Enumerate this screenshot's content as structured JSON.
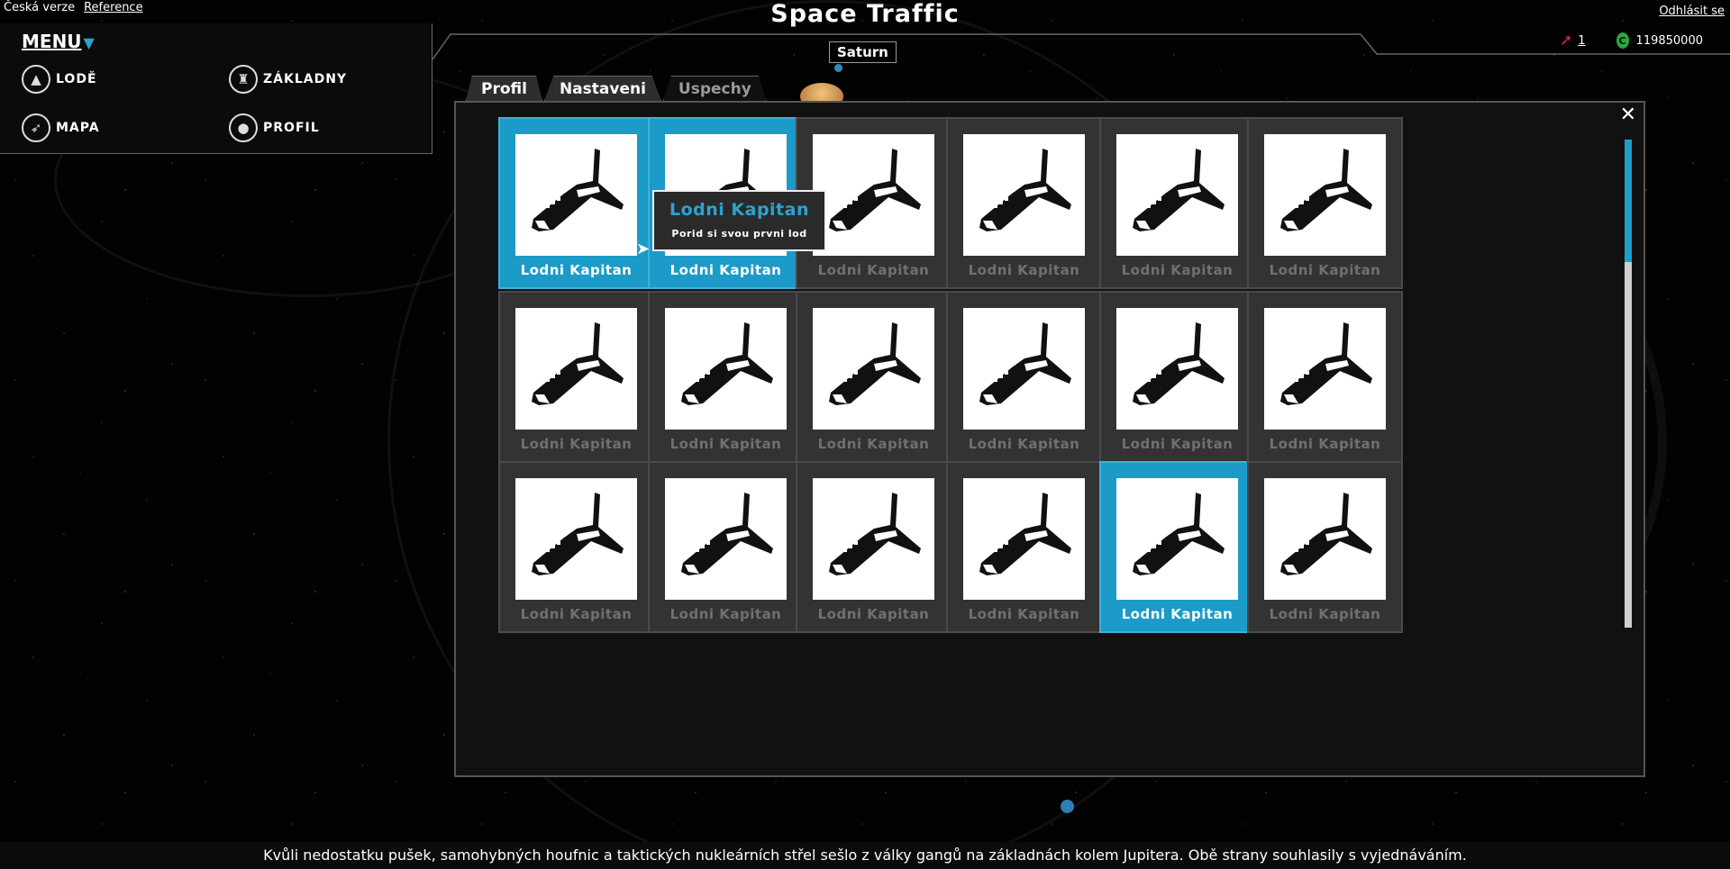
{
  "header": {
    "lang_current": "Česká verze",
    "lang_reference": "Reference",
    "title": "Space Traffic",
    "logout": "Odhlásit se"
  },
  "menu": {
    "toggle_label": "MENU",
    "items": [
      {
        "label": "LODĚ",
        "icon": "ship-icon"
      },
      {
        "label": "ZÁKLADNY",
        "icon": "base-icon"
      },
      {
        "label": "MAPA",
        "icon": "compass-icon"
      },
      {
        "label": "PROFIL",
        "icon": "user-icon"
      }
    ]
  },
  "resources": {
    "ships": "1",
    "credits": "119850000",
    "ships_icon": "rocket-icon",
    "credits_icon": "credit-coin-icon",
    "ships_color": "#e0243a",
    "credits_color": "#2aa63d"
  },
  "map": {
    "planet_label": "Saturn"
  },
  "tabs": [
    {
      "label": "Profil",
      "active": false
    },
    {
      "label": "Nastaveni",
      "active": false
    },
    {
      "label": "Uspechy",
      "active": true
    }
  ],
  "modal": {
    "close_label": "✕",
    "accent_color": "#1c9bc8",
    "achievements": [
      {
        "label": "Lodni Kapitan",
        "achieved": true
      },
      {
        "label": "Lodni Kapitan",
        "achieved": true
      },
      {
        "label": "Lodni Kapitan",
        "achieved": false
      },
      {
        "label": "Lodni Kapitan",
        "achieved": false
      },
      {
        "label": "Lodni Kapitan",
        "achieved": false
      },
      {
        "label": "Lodni Kapitan",
        "achieved": false
      },
      {
        "label": "Lodni Kapitan",
        "achieved": false
      },
      {
        "label": "Lodni Kapitan",
        "achieved": false
      },
      {
        "label": "Lodni Kapitan",
        "achieved": false
      },
      {
        "label": "Lodni Kapitan",
        "achieved": false
      },
      {
        "label": "Lodni Kapitan",
        "achieved": false
      },
      {
        "label": "Lodni Kapitan",
        "achieved": false
      },
      {
        "label": "Lodni Kapitan",
        "achieved": false
      },
      {
        "label": "Lodni Kapitan",
        "achieved": false
      },
      {
        "label": "Lodni Kapitan",
        "achieved": false
      },
      {
        "label": "Lodni Kapitan",
        "achieved": false
      },
      {
        "label": "Lodni Kapitan",
        "achieved": true
      },
      {
        "label": "Lodni Kapitan",
        "achieved": false
      }
    ],
    "tooltip": {
      "title": "Lodni Kapitan",
      "description": "Porid si svou prvni lod"
    }
  },
  "ticker": {
    "text": "Kvůli nedostatku pušek, samohybných houfnic a taktických nukleárních střel sešlo z války gangů na základnách kolem Jupitera. Obě strany souhlasily s vyjednáváním."
  }
}
